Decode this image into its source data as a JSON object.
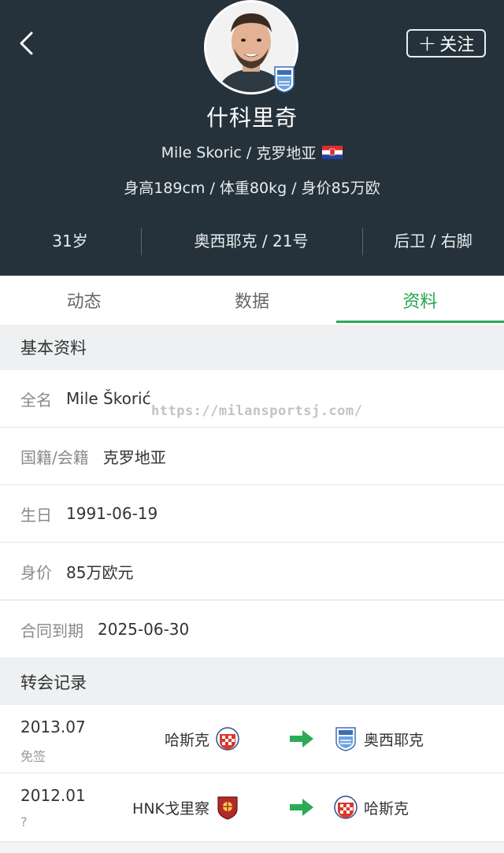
{
  "header": {
    "name": "什科里奇",
    "latin_name": "Mile Skoric",
    "nationality": "克罗地亚",
    "height_weight_value": "身高189cm / 体重80kg / 身价85万欧",
    "follow_label": "关注",
    "age": "31岁",
    "club_number": "奥西耶克 / 21号",
    "position_foot": "后卫 / 右脚"
  },
  "tabs": [
    {
      "label": "动态",
      "active": false
    },
    {
      "label": "数据",
      "active": false
    },
    {
      "label": "资料",
      "active": true
    }
  ],
  "basic_info": {
    "title": "基本资料",
    "rows": [
      {
        "label": "全名",
        "value": "Mile Škorić"
      },
      {
        "label": "国籍/会籍",
        "value": "克罗地亚"
      },
      {
        "label": "生日",
        "value": "1991-06-19"
      },
      {
        "label": "身价",
        "value": "85万欧元"
      },
      {
        "label": "合同到期",
        "value": "2025-06-30"
      }
    ]
  },
  "watermark": "https://milansportsj.com/",
  "transfers": {
    "title": "转会记录",
    "rows": [
      {
        "date": "2013.07",
        "type": "免签",
        "from": "哈斯克",
        "to": "奥西耶克"
      },
      {
        "date": "2012.01",
        "type": "?",
        "from": "HNK戈里察",
        "to": "哈斯克"
      }
    ]
  },
  "icons": {
    "back": "chevron-left-icon",
    "flag": "croatia-flag-icon",
    "arrow": "green-arrow-right-icon"
  },
  "colors": {
    "header_bg": "#26323b",
    "accent": "#23a44c"
  }
}
